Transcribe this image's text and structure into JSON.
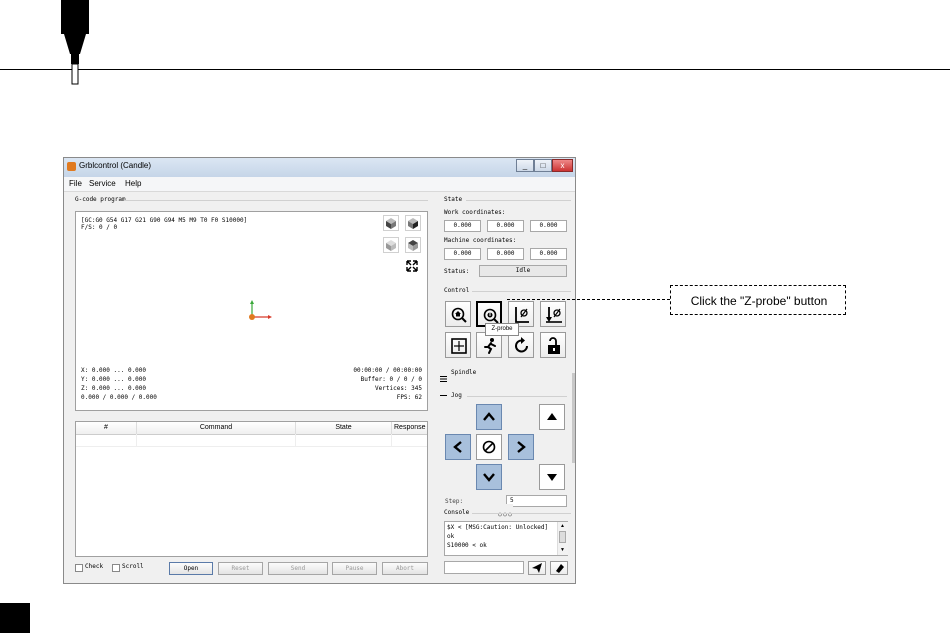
{
  "window": {
    "title": "Grblcontrol (Candle)",
    "minimize": "_",
    "maximize": "□",
    "close": "x"
  },
  "menu": [
    "File",
    "Service",
    "Help"
  ],
  "gcode": {
    "group_title": "G-code program",
    "header_line1": "[GC:G0 G54 G17 G21 G90 G94 M5 M9 T0 F0 S10000]",
    "header_line2": "F/S: 0 / 0",
    "coords": [
      "X: 0.000 ... 0.000",
      "Y: 0.000 ... 0.000",
      "Z: 0.000 ... 0.000",
      "0.000 / 0.000 / 0.000"
    ],
    "stats": [
      "00:00:00 / 00:00:00",
      "Buffer: 0 / 0 / 0",
      "Vertices: 345",
      "FPS: 62"
    ]
  },
  "table": {
    "columns": [
      "#",
      "Command",
      "State",
      "Response"
    ]
  },
  "bottom": {
    "check_label": "Check",
    "scroll_label": "Scroll",
    "open": "Open",
    "reset": "Reset",
    "send": "Send",
    "pause": "Pause",
    "abort": "Abort"
  },
  "state": {
    "group_title": "State",
    "work_label": "Work coordinates:",
    "work": [
      "0.000",
      "0.000",
      "0.000"
    ],
    "machine_label": "Machine coordinates:",
    "machine": [
      "0.000",
      "0.000",
      "0.000"
    ],
    "status_label": "Status:",
    "status_value": "Idle"
  },
  "control": {
    "group_title": "Control",
    "tooltip": "Z-probe",
    "buttons": [
      "home-icon",
      "z-probe-icon",
      "zero-xy-icon",
      "zero-z-icon",
      "restore-origin-icon",
      "safe-position-icon",
      "soft-reset-icon",
      "unlock-icon"
    ]
  },
  "spindle": {
    "label": "Spindle"
  },
  "jog": {
    "label": "Jog",
    "step_label": "Step:",
    "step_value": "5"
  },
  "console": {
    "group_title": "Console",
    "lines": [
      "$X < [MSG:Caution: Unlocked]",
      "ok",
      "S10000 < ok"
    ],
    "input_placeholder": ""
  },
  "callout": {
    "text": "Click the \"Z-probe\" button"
  },
  "colors": {
    "jog_active": "#a8c0dc",
    "status_accent": "#e07a20"
  }
}
